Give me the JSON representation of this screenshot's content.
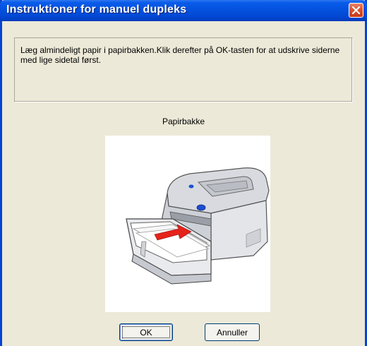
{
  "window": {
    "title": "Instruktioner for manuel dupleks"
  },
  "message": "Læg almindeligt papir i papirbakken.Klik derefter på OK-tasten for at udskrive siderne med lige sidetal først.",
  "image_label": "Papirbakke",
  "buttons": {
    "ok": "OK",
    "cancel": "Annuller"
  },
  "colors": {
    "titlebar": "#0453e0",
    "dialog_bg": "#ece9d8",
    "close": "#d9502e"
  },
  "icons": {
    "close": "close-icon",
    "illustration": "printer-paper-tray-illustration"
  }
}
